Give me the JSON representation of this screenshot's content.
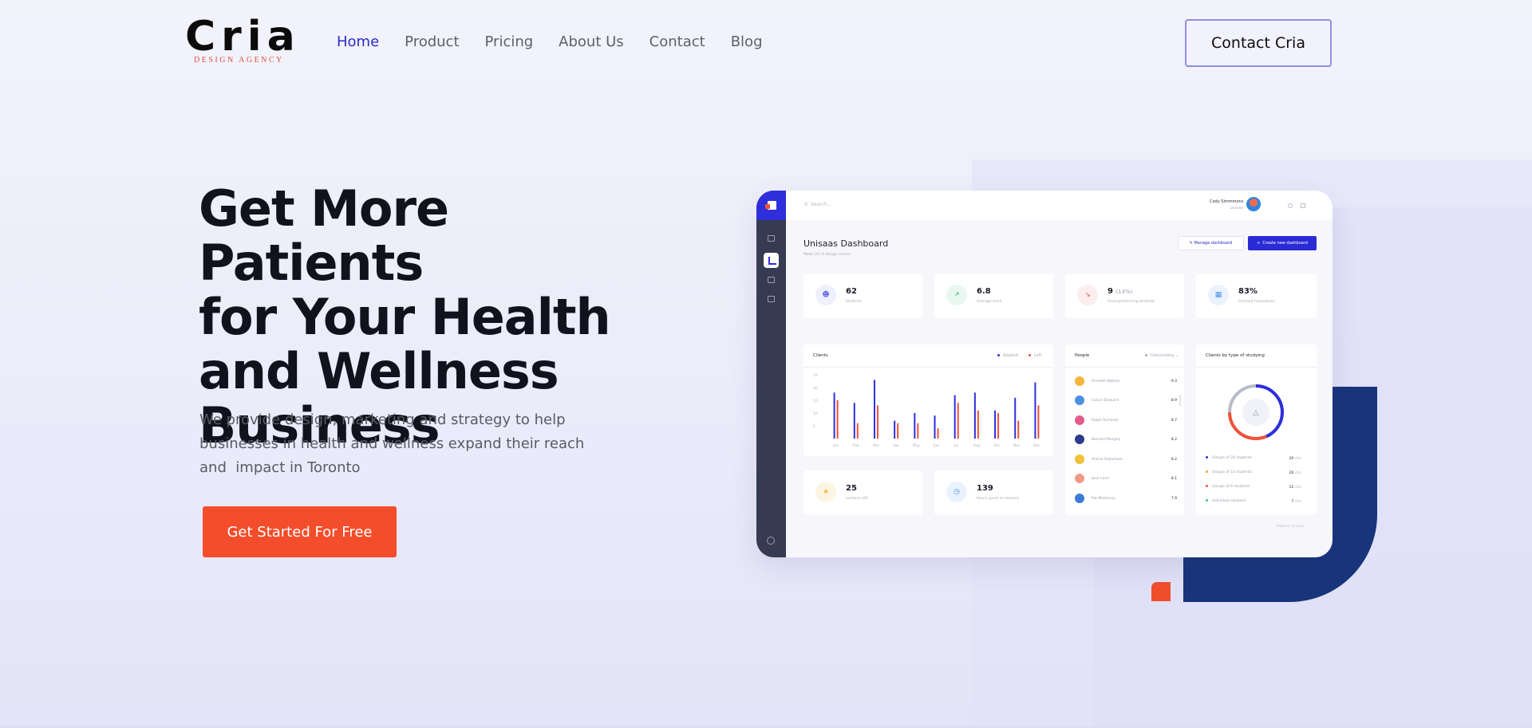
{
  "brand": {
    "name": "Cria",
    "tagline": "DESIGN AGENCY"
  },
  "nav": {
    "items": [
      {
        "label": "Home",
        "active": true
      },
      {
        "label": "Product",
        "active": false
      },
      {
        "label": "Pricing",
        "active": false
      },
      {
        "label": "About Us",
        "active": false
      },
      {
        "label": "Contact",
        "active": false
      },
      {
        "label": "Blog",
        "active": false
      }
    ],
    "contact_button": "Contact Cria"
  },
  "hero": {
    "title_lines": [
      "Get More Patients",
      "for Your Health",
      "and Wellness",
      "Business"
    ],
    "subtitle_lines": [
      "We provide design, marketing and strategy to help",
      "businesses in health and wellness expand their reach",
      "and  impact in Toronto"
    ],
    "cta": "Get Started For Free"
  },
  "colors": {
    "accent": "#2b2bc4",
    "cta": "#f44d2b",
    "navy": "#18347a",
    "dash_blue": "#2e2edb",
    "dash_red": "#f0523a"
  },
  "dashboard": {
    "search_placeholder": "Search...",
    "user_name": "Cody Simmmons",
    "user_role": "Lecturer",
    "title": "Unisaas Dashboard",
    "subtitle": "Made UX UI design course",
    "manage_button": "Manage dashboard",
    "create_button": "Create new dashboard",
    "stats": [
      {
        "value": "62",
        "suffix": "",
        "label": "Students",
        "icon": "user-icon"
      },
      {
        "value": "6.8",
        "suffix": "",
        "label": "Average mark",
        "icon": "trend-icon"
      },
      {
        "value": "9",
        "suffix": "(14%)",
        "label": "Underperforming students",
        "icon": "trend-down-icon"
      },
      {
        "value": "83%",
        "suffix": "",
        "label": "Finished homeworks",
        "icon": "book-icon"
      }
    ],
    "stats_bottom": [
      {
        "value": "25",
        "label": "Lections left",
        "icon": "trophy-icon"
      },
      {
        "value": "139",
        "label": "Hours spent on lections",
        "icon": "clock-icon"
      }
    ],
    "clients_title": "Clients",
    "legend_applied": "Applied",
    "legend_left": "Left",
    "people_title": "People",
    "people_sort": "Descending",
    "people": [
      {
        "name": "Annette Watson",
        "score": "9.3",
        "color": "#f5b73c"
      },
      {
        "name": "Calvin Steward",
        "score": "8.9",
        "color": "#4a90e2"
      },
      {
        "name": "Ralph Richards",
        "score": "8.7",
        "color": "#e45b8c"
      },
      {
        "name": "Bernard Murphy",
        "score": "8.2",
        "color": "#2e3a8c"
      },
      {
        "name": "Arlene Robertson",
        "score": "8.2",
        "color": "#f0c23a"
      },
      {
        "name": "Jane Lane",
        "score": "8.1",
        "color": "#f29a8a"
      },
      {
        "name": "Pat Mckinney",
        "score": "7.9",
        "color": "#3a7bd5"
      }
    ],
    "donut_title": "Clients by type of studying",
    "groups": [
      {
        "label": "Groups of 20 students",
        "count": "20",
        "unit": "stds",
        "color": "#2e2edb"
      },
      {
        "label": "Groups of 10 students",
        "count": "20",
        "unit": "stds",
        "color": "#f5a623"
      },
      {
        "label": "Groups of 6 students",
        "count": "15",
        "unit": "stds",
        "color": "#f0523a"
      },
      {
        "label": "Individual sessions",
        "count": "7",
        "unit": "stds",
        "color": "#2ecc9a"
      }
    ],
    "credit": "Made by Unisaas"
  },
  "chart_data": {
    "type": "bar",
    "title": "Clients",
    "categories": [
      "Jan",
      "Feb",
      "Mar",
      "Apr",
      "May",
      "Jun",
      "Jul",
      "Aug",
      "Oct",
      "Nov",
      "Dec"
    ],
    "yticks": [
      "25",
      "20",
      "15",
      "10",
      "5"
    ],
    "ylim": [
      0,
      25
    ],
    "series": [
      {
        "name": "Applied",
        "values": [
          18,
          14,
          23,
          7,
          10,
          9,
          17,
          18,
          11,
          16,
          22
        ]
      },
      {
        "name": "Left",
        "values": [
          15,
          6,
          13,
          6,
          6,
          4,
          14,
          11,
          10,
          7,
          13
        ]
      }
    ]
  }
}
